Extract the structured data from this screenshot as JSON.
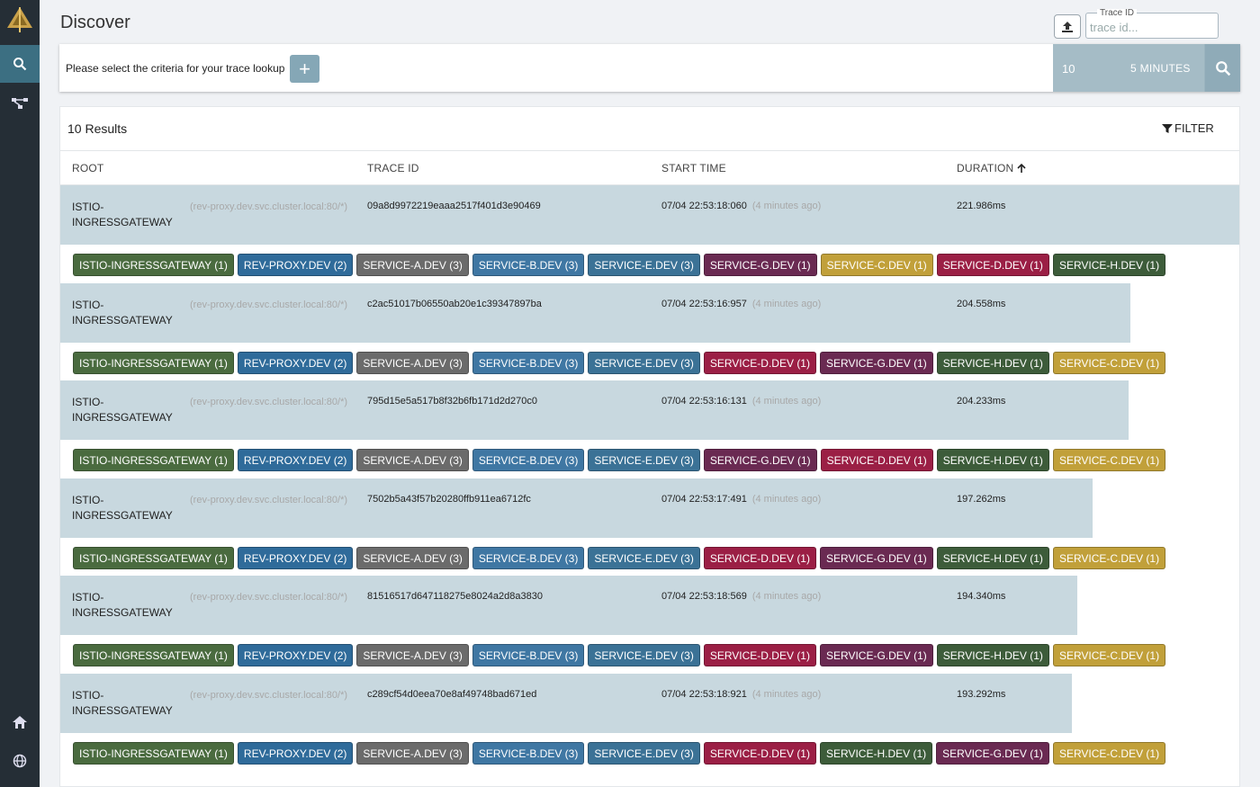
{
  "nav": {
    "items": [
      {
        "name": "search",
        "active": true
      },
      {
        "name": "dependencies",
        "active": false
      }
    ],
    "bottom_items": [
      "home",
      "globe"
    ]
  },
  "page": {
    "title": "Discover",
    "trace_id_label": "Trace ID",
    "trace_id_placeholder": "trace id...",
    "criteria_text": "Please select the criteria for your trace lookup",
    "limit": "10",
    "time_range": "5 MINUTES",
    "results_count": "10 Results",
    "filter_label": "FILTER"
  },
  "columns": {
    "root": "ROOT",
    "trace_id": "TRACE ID",
    "start_time": "START TIME",
    "duration": "DURATION"
  },
  "colors": {
    "ISTIO-INGRESSGATEWAY": "#4a6b3f",
    "REV-PROXY.DEV": "#2f6b9a",
    "SERVICE-A.DEV": "#6b6b6b",
    "SERVICE-B.DEV": "#3f77a3",
    "SERVICE-E.DEV": "#3b7296",
    "SERVICE-G.DEV": "#6a2a52",
    "SERVICE-C.DEV": "#c1a03a",
    "SERVICE-D.DEV": "#9b1f45",
    "SERVICE-H.DEV": "#3d5c3a",
    "bar": "#c8d8df"
  },
  "traces": [
    {
      "root": "ISTIO-INGRESSGATEWAY",
      "root_desc": "(rev-proxy.dev.svc.cluster.local:80/*)",
      "trace_id": "09a8d9972219eaaa2517f401d3e90469",
      "start_time": "07/04 22:53:18:060",
      "ago": "(4 minutes ago)",
      "duration": "221.986ms",
      "duration_ms": 221.986,
      "services": [
        {
          "name": "ISTIO-INGRESSGATEWAY",
          "label": "ISTIO-INGRESSGATEWAY (1)"
        },
        {
          "name": "REV-PROXY.DEV",
          "label": "REV-PROXY.DEV (2)"
        },
        {
          "name": "SERVICE-A.DEV",
          "label": "SERVICE-A.DEV (3)"
        },
        {
          "name": "SERVICE-B.DEV",
          "label": "SERVICE-B.DEV (3)"
        },
        {
          "name": "SERVICE-E.DEV",
          "label": "SERVICE-E.DEV (3)"
        },
        {
          "name": "SERVICE-G.DEV",
          "label": "SERVICE-G.DEV (1)"
        },
        {
          "name": "SERVICE-C.DEV",
          "label": "SERVICE-C.DEV (1)"
        },
        {
          "name": "SERVICE-D.DEV",
          "label": "SERVICE-D.DEV (1)"
        },
        {
          "name": "SERVICE-H.DEV",
          "label": "SERVICE-H.DEV (1)"
        }
      ]
    },
    {
      "root": "ISTIO-INGRESSGATEWAY",
      "root_desc": "(rev-proxy.dev.svc.cluster.local:80/*)",
      "trace_id": "c2ac51017b06550ab20e1c39347897ba",
      "start_time": "07/04 22:53:16:957",
      "ago": "(4 minutes ago)",
      "duration": "204.558ms",
      "duration_ms": 204.558,
      "services": [
        {
          "name": "ISTIO-INGRESSGATEWAY",
          "label": "ISTIO-INGRESSGATEWAY (1)"
        },
        {
          "name": "REV-PROXY.DEV",
          "label": "REV-PROXY.DEV (2)"
        },
        {
          "name": "SERVICE-A.DEV",
          "label": "SERVICE-A.DEV (3)"
        },
        {
          "name": "SERVICE-B.DEV",
          "label": "SERVICE-B.DEV (3)"
        },
        {
          "name": "SERVICE-E.DEV",
          "label": "SERVICE-E.DEV (3)"
        },
        {
          "name": "SERVICE-D.DEV",
          "label": "SERVICE-D.DEV (1)"
        },
        {
          "name": "SERVICE-G.DEV",
          "label": "SERVICE-G.DEV (1)"
        },
        {
          "name": "SERVICE-H.DEV",
          "label": "SERVICE-H.DEV (1)"
        },
        {
          "name": "SERVICE-C.DEV",
          "label": "SERVICE-C.DEV (1)"
        }
      ]
    },
    {
      "root": "ISTIO-INGRESSGATEWAY",
      "root_desc": "(rev-proxy.dev.svc.cluster.local:80/*)",
      "trace_id": "795d15e5a517b8f32b6fb171d2d270c0",
      "start_time": "07/04 22:53:16:131",
      "ago": "(4 minutes ago)",
      "duration": "204.233ms",
      "duration_ms": 204.233,
      "services": [
        {
          "name": "ISTIO-INGRESSGATEWAY",
          "label": "ISTIO-INGRESSGATEWAY (1)"
        },
        {
          "name": "REV-PROXY.DEV",
          "label": "REV-PROXY.DEV (2)"
        },
        {
          "name": "SERVICE-A.DEV",
          "label": "SERVICE-A.DEV (3)"
        },
        {
          "name": "SERVICE-B.DEV",
          "label": "SERVICE-B.DEV (3)"
        },
        {
          "name": "SERVICE-E.DEV",
          "label": "SERVICE-E.DEV (3)"
        },
        {
          "name": "SERVICE-G.DEV",
          "label": "SERVICE-G.DEV (1)"
        },
        {
          "name": "SERVICE-D.DEV",
          "label": "SERVICE-D.DEV (1)"
        },
        {
          "name": "SERVICE-H.DEV",
          "label": "SERVICE-H.DEV (1)"
        },
        {
          "name": "SERVICE-C.DEV",
          "label": "SERVICE-C.DEV (1)"
        }
      ]
    },
    {
      "root": "ISTIO-INGRESSGATEWAY",
      "root_desc": "(rev-proxy.dev.svc.cluster.local:80/*)",
      "trace_id": "7502b5a43f57b20280ffb911ea6712fc",
      "start_time": "07/04 22:53:17:491",
      "ago": "(4 minutes ago)",
      "duration": "197.262ms",
      "duration_ms": 197.262,
      "services": [
        {
          "name": "ISTIO-INGRESSGATEWAY",
          "label": "ISTIO-INGRESSGATEWAY (1)"
        },
        {
          "name": "REV-PROXY.DEV",
          "label": "REV-PROXY.DEV (2)"
        },
        {
          "name": "SERVICE-A.DEV",
          "label": "SERVICE-A.DEV (3)"
        },
        {
          "name": "SERVICE-B.DEV",
          "label": "SERVICE-B.DEV (3)"
        },
        {
          "name": "SERVICE-E.DEV",
          "label": "SERVICE-E.DEV (3)"
        },
        {
          "name": "SERVICE-D.DEV",
          "label": "SERVICE-D.DEV (1)"
        },
        {
          "name": "SERVICE-G.DEV",
          "label": "SERVICE-G.DEV (1)"
        },
        {
          "name": "SERVICE-H.DEV",
          "label": "SERVICE-H.DEV (1)"
        },
        {
          "name": "SERVICE-C.DEV",
          "label": "SERVICE-C.DEV (1)"
        }
      ]
    },
    {
      "root": "ISTIO-INGRESSGATEWAY",
      "root_desc": "(rev-proxy.dev.svc.cluster.local:80/*)",
      "trace_id": "81516517d647118275e8024a2d8a3830",
      "start_time": "07/04 22:53:18:569",
      "ago": "(4 minutes ago)",
      "duration": "194.340ms",
      "duration_ms": 194.34,
      "services": [
        {
          "name": "ISTIO-INGRESSGATEWAY",
          "label": "ISTIO-INGRESSGATEWAY (1)"
        },
        {
          "name": "REV-PROXY.DEV",
          "label": "REV-PROXY.DEV (2)"
        },
        {
          "name": "SERVICE-A.DEV",
          "label": "SERVICE-A.DEV (3)"
        },
        {
          "name": "SERVICE-B.DEV",
          "label": "SERVICE-B.DEV (3)"
        },
        {
          "name": "SERVICE-E.DEV",
          "label": "SERVICE-E.DEV (3)"
        },
        {
          "name": "SERVICE-D.DEV",
          "label": "SERVICE-D.DEV (1)"
        },
        {
          "name": "SERVICE-G.DEV",
          "label": "SERVICE-G.DEV (1)"
        },
        {
          "name": "SERVICE-H.DEV",
          "label": "SERVICE-H.DEV (1)"
        },
        {
          "name": "SERVICE-C.DEV",
          "label": "SERVICE-C.DEV (1)"
        }
      ]
    },
    {
      "root": "ISTIO-INGRESSGATEWAY",
      "root_desc": "(rev-proxy.dev.svc.cluster.local:80/*)",
      "trace_id": "c289cf54d0eea70e8af49748bad671ed",
      "start_time": "07/04 22:53:18:921",
      "ago": "(4 minutes ago)",
      "duration": "193.292ms",
      "duration_ms": 193.292,
      "services": [
        {
          "name": "ISTIO-INGRESSGATEWAY",
          "label": "ISTIO-INGRESSGATEWAY (1)"
        },
        {
          "name": "REV-PROXY.DEV",
          "label": "REV-PROXY.DEV (2)"
        },
        {
          "name": "SERVICE-A.DEV",
          "label": "SERVICE-A.DEV (3)"
        },
        {
          "name": "SERVICE-B.DEV",
          "label": "SERVICE-B.DEV (3)"
        },
        {
          "name": "SERVICE-E.DEV",
          "label": "SERVICE-E.DEV (3)"
        },
        {
          "name": "SERVICE-D.DEV",
          "label": "SERVICE-D.DEV (1)"
        },
        {
          "name": "SERVICE-H.DEV",
          "label": "SERVICE-H.DEV (1)"
        },
        {
          "name": "SERVICE-G.DEV",
          "label": "SERVICE-G.DEV (1)"
        },
        {
          "name": "SERVICE-C.DEV",
          "label": "SERVICE-C.DEV (1)"
        }
      ]
    }
  ]
}
